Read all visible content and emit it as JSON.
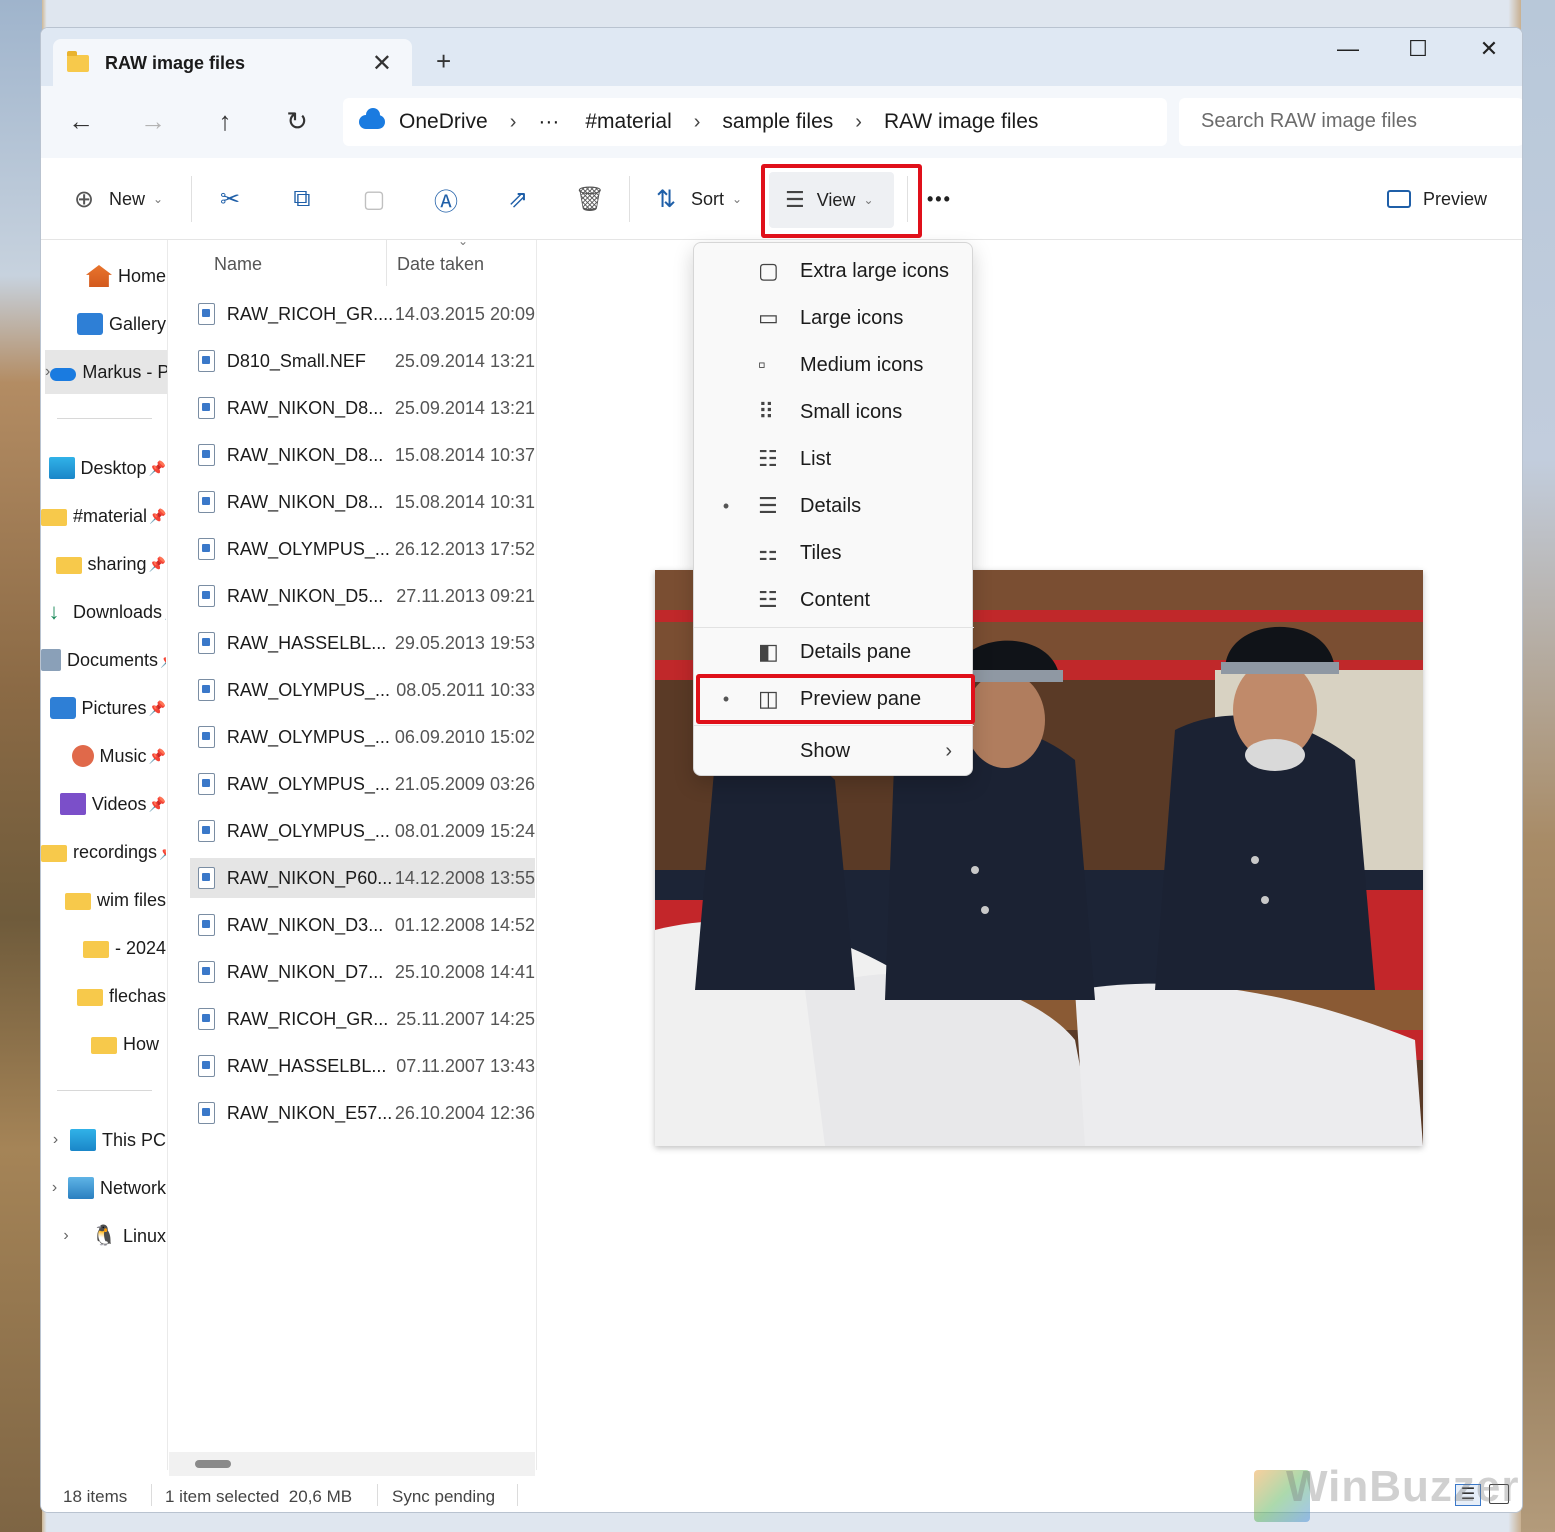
{
  "tab": {
    "title": "RAW image files",
    "close": "✕",
    "new_tab": "+"
  },
  "window_controls": {
    "minimize": "—",
    "maximize": "☐",
    "close": "✕"
  },
  "nav": {
    "back": "←",
    "forward": "→",
    "up": "↑",
    "refresh": "↻"
  },
  "breadcrumb": {
    "items": [
      "OneDrive",
      "···",
      "#material",
      "sample files",
      "RAW image files"
    ],
    "separator": "›"
  },
  "search": {
    "placeholder": "Search RAW image files"
  },
  "toolbar": {
    "new_label": "New",
    "sort_label": "Sort",
    "view_label": "View",
    "more_label": "•••",
    "preview_label": "Preview",
    "dropdown_caret": "⌄"
  },
  "sidebar": {
    "items": [
      {
        "label": "Home",
        "icon": "home-icon"
      },
      {
        "label": "Gallery",
        "icon": "gallery-icon"
      },
      {
        "label": "Markus - Personal",
        "icon": "onedrive-icon"
      },
      {
        "label": "Desktop",
        "icon": "desktop-icon"
      },
      {
        "label": "#material",
        "icon": "folder-icon"
      },
      {
        "label": "sharing",
        "icon": "folder-icon"
      },
      {
        "label": "Downloads",
        "icon": "download-icon"
      },
      {
        "label": "Documents",
        "icon": "documents-icon"
      },
      {
        "label": "Pictures",
        "icon": "pictures-icon"
      },
      {
        "label": "Music",
        "icon": "music-icon"
      },
      {
        "label": "Videos",
        "icon": "videos-icon"
      },
      {
        "label": "recordings",
        "icon": "folder-icon"
      },
      {
        "label": "wim files",
        "icon": "folder-icon"
      },
      {
        "label": "- 2024",
        "icon": "folder-icon"
      },
      {
        "label": "flechas",
        "icon": "folder-icon"
      },
      {
        "label": "How",
        "icon": "folder-icon"
      },
      {
        "label": "This PC",
        "icon": "pc-icon"
      },
      {
        "label": "Network",
        "icon": "network-icon"
      },
      {
        "label": "Linux",
        "icon": "linux-icon"
      }
    ]
  },
  "filelist": {
    "columns": [
      "Name",
      "Date taken"
    ],
    "rows": [
      {
        "name": "RAW_RICOH_GR....",
        "date": "14.03.2015 20:09"
      },
      {
        "name": "D810_Small.NEF",
        "date": "25.09.2014 13:21"
      },
      {
        "name": "RAW_NIKON_D8...",
        "date": "25.09.2014 13:21"
      },
      {
        "name": "RAW_NIKON_D8...",
        "date": "15.08.2014 10:37"
      },
      {
        "name": "RAW_NIKON_D8...",
        "date": "15.08.2014 10:31"
      },
      {
        "name": "RAW_OLYMPUS_...",
        "date": "26.12.2013 17:52"
      },
      {
        "name": "RAW_NIKON_D5...",
        "date": "27.11.2013 09:21"
      },
      {
        "name": "RAW_HASSELBL...",
        "date": "29.05.2013 19:53"
      },
      {
        "name": "RAW_OLYMPUS_...",
        "date": "08.05.2011 10:33"
      },
      {
        "name": "RAW_OLYMPUS_...",
        "date": "06.09.2010 15:02"
      },
      {
        "name": "RAW_OLYMPUS_...",
        "date": "21.05.2009 03:26"
      },
      {
        "name": "RAW_OLYMPUS_...",
        "date": "08.01.2009 15:24"
      },
      {
        "name": "RAW_NIKON_P60...",
        "date": "14.12.2008 13:55"
      },
      {
        "name": "RAW_NIKON_D3...",
        "date": "01.12.2008 14:52"
      },
      {
        "name": "RAW_NIKON_D7...",
        "date": "25.10.2008 14:41"
      },
      {
        "name": "RAW_RICOH_GR...",
        "date": "25.11.2007 14:25"
      },
      {
        "name": "RAW_HASSELBL...",
        "date": "07.11.2007 13:43"
      },
      {
        "name": "RAW_NIKON_E57...",
        "date": "26.10.2004 12:36"
      }
    ]
  },
  "view_menu": {
    "items": [
      {
        "label": "Extra large icons",
        "icon": "extra-large-icons-icon"
      },
      {
        "label": "Large icons",
        "icon": "large-icons-icon"
      },
      {
        "label": "Medium icons",
        "icon": "medium-icons-icon"
      },
      {
        "label": "Small icons",
        "icon": "small-icons-icon"
      },
      {
        "label": "List",
        "icon": "list-icon"
      },
      {
        "label": "Details",
        "icon": "details-icon"
      },
      {
        "label": "Tiles",
        "icon": "tiles-icon"
      },
      {
        "label": "Content",
        "icon": "content-icon"
      },
      {
        "label": "Details pane",
        "icon": "details-pane-icon"
      },
      {
        "label": "Preview pane",
        "icon": "preview-pane-icon"
      },
      {
        "label": "Show",
        "icon": ""
      }
    ],
    "bullet": "•",
    "submenu_arrow": "›"
  },
  "status": {
    "item_count": "18 items",
    "selection": "1 item selected  20,6 MB",
    "sync": "Sync pending"
  },
  "watermark": "WinBuzzer",
  "colors": {
    "highlight": "#e0101a",
    "accent": "#1a7be0"
  }
}
